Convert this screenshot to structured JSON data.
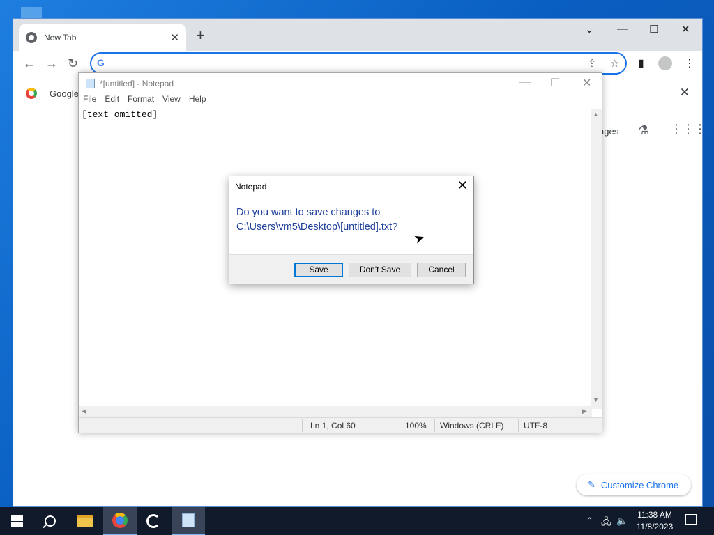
{
  "chrome": {
    "tab_title": "New Tab",
    "new_tab": "+",
    "minimize": "⌄",
    "win_min": "—",
    "win_max": "☐",
    "win_close": "✕",
    "back": "←",
    "forward": "→",
    "reload": "↻",
    "omnibox_g": "G",
    "omnibox_value": "",
    "share": "⇪",
    "star": "☆",
    "side_panel": "▮",
    "menu": "⋮",
    "bookmark_label": "Google",
    "bookmark_close": "✕",
    "images_link": "ages",
    "labs": "⚗",
    "apps": "⋮⋮⋮",
    "customize_icon": "✎",
    "customize_label": "Customize Chrome",
    "accent": "#1a73e8"
  },
  "notepad": {
    "title": "*[untitled] - Notepad",
    "min": "—",
    "max": "☐",
    "close": "✕",
    "menu": [
      "File",
      "Edit",
      "Format",
      "View",
      "Help"
    ],
    "content": "[text omitted]",
    "status": {
      "position": "Ln 1, Col 60",
      "zoom": "100%",
      "line_endings": "Windows (CRLF)",
      "encoding": "UTF-8"
    }
  },
  "dialog": {
    "title": "Notepad",
    "close": "✕",
    "message_line1": "Do you want to save changes to",
    "message_line2": "C:\\Users\\vm5\\Desktop\\[untitled].txt?",
    "save": "Save",
    "dont_save": "Don't Save",
    "cancel": "Cancel",
    "message_color": "#1e3f9b"
  },
  "taskbar": {
    "tray_chevron": "⌃",
    "network": "🖧",
    "volume": "🔈",
    "time": "11:38 AM",
    "date": "11/8/2023"
  }
}
